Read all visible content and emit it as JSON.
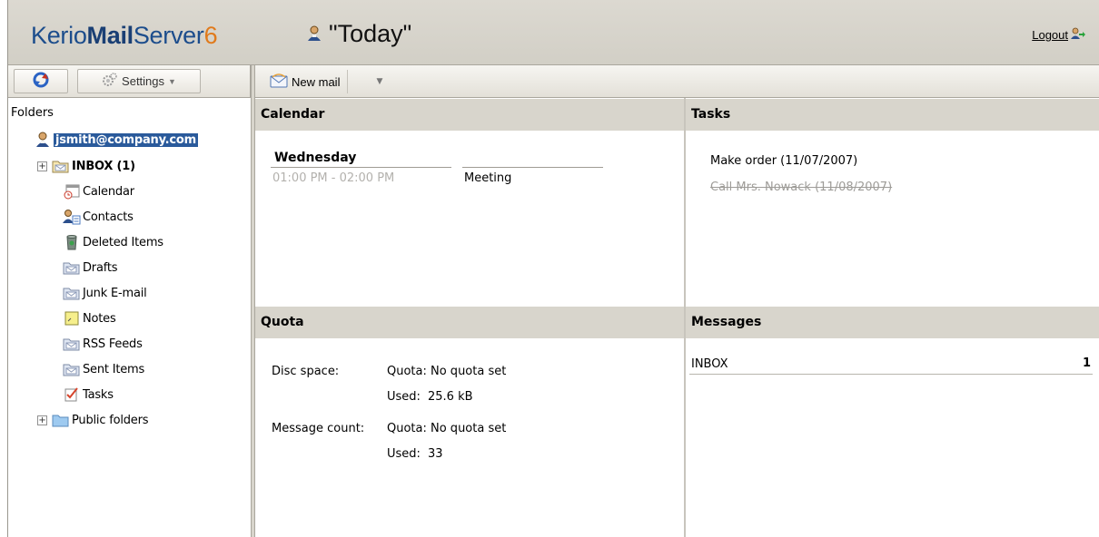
{
  "header": {
    "logo_prefix": "Kerio",
    "logo_mail": "Mail",
    "logo_server": "Server",
    "logo_version": "6",
    "view_title": "\"Today\"",
    "logout_label": "Logout"
  },
  "toolbar_left": {
    "settings_label": "Settings"
  },
  "toolbar_right": {
    "new_mail_label": "New mail"
  },
  "folders": {
    "header": "Folders",
    "account": "jsmith@company.com",
    "items": [
      {
        "label": "INBOX (1)",
        "icon": "folder-open-icon"
      },
      {
        "label": "Calendar",
        "icon": "calendar-icon"
      },
      {
        "label": "Contacts",
        "icon": "contacts-icon"
      },
      {
        "label": "Deleted Items",
        "icon": "trash-icon"
      },
      {
        "label": "Drafts",
        "icon": "mail-folder-icon"
      },
      {
        "label": "Junk E-mail",
        "icon": "mail-folder-icon"
      },
      {
        "label": "Notes",
        "icon": "notes-icon"
      },
      {
        "label": "RSS Feeds",
        "icon": "mail-folder-icon"
      },
      {
        "label": "Sent Items",
        "icon": "mail-folder-icon"
      },
      {
        "label": "Tasks",
        "icon": "tasks-icon"
      },
      {
        "label": "Public folders",
        "icon": "folder-icon"
      }
    ]
  },
  "calendar": {
    "title": "Calendar",
    "day": "Wednesday",
    "events": [
      {
        "time": "01:00 PM - 02:00 PM",
        "subject": "Meeting"
      }
    ]
  },
  "tasks": {
    "title": "Tasks",
    "items": [
      {
        "label": "Make order (11/07/2007)",
        "completed": false
      },
      {
        "label": "Call Mrs. Nowack (11/08/2007)",
        "completed": true
      }
    ]
  },
  "quota": {
    "title": "Quota",
    "disc_label": "Disc space:",
    "disc_quota": "Quota: No quota set",
    "disc_used_label": "Used:",
    "disc_used_value": "25.6 kB",
    "msg_label": "Message count:",
    "msg_quota": "Quota: No quota set",
    "msg_used_label": "Used:",
    "msg_used_value": "33"
  },
  "messages": {
    "title": "Messages",
    "rows": [
      {
        "folder": "INBOX",
        "count": "1"
      }
    ]
  },
  "colors": {
    "selection": "#2a5a9b",
    "panel_header": "#d8d5cc",
    "logo_blue": "#1c4d8c",
    "logo_orange": "#e07a1b"
  }
}
